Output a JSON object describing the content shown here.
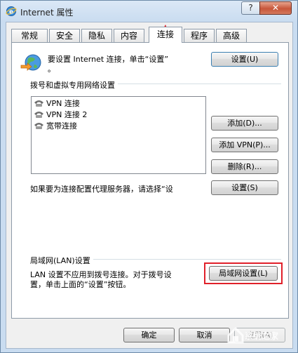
{
  "window": {
    "title": "Internet 属性",
    "help_label": "?",
    "close_label": "✕"
  },
  "tabs": [
    {
      "label": "常规"
    },
    {
      "label": "安全"
    },
    {
      "label": "隐私"
    },
    {
      "label": "内容"
    },
    {
      "label": "连接",
      "active": true
    },
    {
      "label": "程序"
    },
    {
      "label": "高级"
    }
  ],
  "setup": {
    "text_line1": "要设置 Internet 连接，单击“设置”",
    "text_line2": "。",
    "button": "设置(U)"
  },
  "dialup": {
    "group_label": "拨号和虚拟专用网络设置",
    "connections": [
      "VPN 连接",
      "VPN 连接 2",
      "宽带连接"
    ],
    "add_button": "添加(D)...",
    "add_vpn_button": "添加 VPN(P)...",
    "remove_button": "删除(R)...",
    "proxy_text": "如果要为连接配置代理服务器，请选择“设",
    "settings_button": "设置(S)"
  },
  "lan": {
    "group_label": "局域网(LAN)设置",
    "text_line1": "LAN 设置不应用到拨号连接。对于拨号设",
    "text_line2": "置，单击上面的“设置”按钮。",
    "button": "局域网设置(L)"
  },
  "footer": {
    "ok": "确定",
    "cancel": "取消",
    "apply": "应用(A)"
  },
  "watermark": {
    "text": "系统之家"
  },
  "colors": {
    "highlight": "#e0202a",
    "arrow": "#e0202a"
  }
}
